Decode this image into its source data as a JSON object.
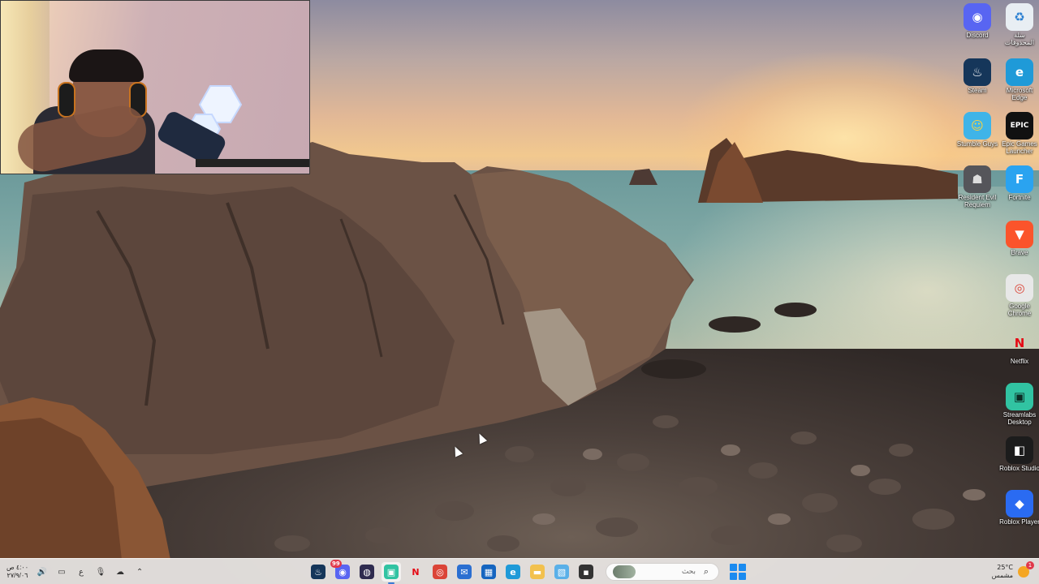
{
  "desktop": {
    "icons": [
      {
        "name": "recycle-bin",
        "label": "سلة المحذوفات",
        "glyph": "♻",
        "color": "#e8eef3",
        "fg": "#2a7fd1"
      },
      {
        "name": "discord",
        "label": "Discord",
        "glyph": "◉",
        "color": "#5865f2",
        "fg": "#ffffff"
      },
      {
        "name": "microsoft-edge",
        "label": "Microsoft Edge",
        "glyph": "e",
        "color": "#1f9ad8",
        "fg": "#ffffff"
      },
      {
        "name": "steam",
        "label": "Steam",
        "glyph": "♨",
        "color": "#15365a",
        "fg": "#ffffff"
      },
      {
        "name": "epic-games-launcher",
        "label": "Epic Games Launcher",
        "glyph": "EPIC",
        "color": "#111111",
        "fg": "#ffffff"
      },
      {
        "name": "stumble-guys",
        "label": "Stumble Guys",
        "glyph": "☺",
        "color": "#3fb4e8",
        "fg": "#ffd23a"
      },
      {
        "name": "fortnite",
        "label": "Fortnite",
        "glyph": "F",
        "color": "#2aa3f0",
        "fg": "#ffffff"
      },
      {
        "name": "resident-evil",
        "label": "Resident Evil Requiem",
        "glyph": "☗",
        "color": "#55555a",
        "fg": "#dddddd"
      },
      {
        "name": "brave",
        "label": "Brave",
        "glyph": "▼",
        "color": "#fb542b",
        "fg": "#ffffff"
      },
      {
        "name": "google-chrome",
        "label": "Google Chrome",
        "glyph": "◎",
        "color": "#e8e8e8",
        "fg": "#db4437"
      },
      {
        "name": "netflix",
        "label": "Netflix",
        "glyph": "N",
        "color": "transparent",
        "fg": "#e50914"
      },
      {
        "name": "streamlabs-desktop",
        "label": "Streamlabs Desktop",
        "glyph": "▣",
        "color": "#31c3a2",
        "fg": "#0b2b24"
      },
      {
        "name": "roblox-studio",
        "label": "Roblox Studio",
        "glyph": "◧",
        "color": "#1c1c1c",
        "fg": "#ffffff"
      },
      {
        "name": "roblox-player",
        "label": "Roblox Player",
        "glyph": "◆",
        "color": "#2a6bf2",
        "fg": "#ffffff"
      }
    ]
  },
  "taskbar": {
    "clock_time": "٤:٠٠ ص",
    "clock_date": "٢٧/٩/٠٦",
    "tray_lang": "ع",
    "apps": [
      {
        "name": "steam",
        "glyph": "♨",
        "color": "#15365a",
        "active": false
      },
      {
        "name": "discord",
        "glyph": "◉",
        "color": "#5865f2",
        "active": false,
        "badge": "99"
      },
      {
        "name": "obs",
        "glyph": "◍",
        "color": "#2e2b4f",
        "active": false
      },
      {
        "name": "streamlabs",
        "glyph": "▣",
        "color": "#31c3a2",
        "active": true
      },
      {
        "name": "netflix",
        "glyph": "N",
        "color": "transparent",
        "fg": "#e50914",
        "active": false
      },
      {
        "name": "chrome",
        "glyph": "◎",
        "color": "#db4437",
        "active": false
      },
      {
        "name": "mail",
        "glyph": "✉",
        "color": "#2b6fd1",
        "active": false
      },
      {
        "name": "store",
        "glyph": "▦",
        "color": "#1565c0",
        "active": false
      },
      {
        "name": "edge",
        "glyph": "e",
        "color": "#1f9ad8",
        "active": false
      },
      {
        "name": "file-explorer",
        "glyph": "▬",
        "color": "#f2c14e",
        "active": false
      },
      {
        "name": "photos",
        "glyph": "▧",
        "color": "#5ab0e8",
        "active": false
      },
      {
        "name": "terminal",
        "glyph": "▪",
        "color": "#333333",
        "active": false
      }
    ],
    "search_placeholder": "بحث",
    "weather_temp": "25°C",
    "weather_desc": "مشمس",
    "weather_badge": "1"
  }
}
